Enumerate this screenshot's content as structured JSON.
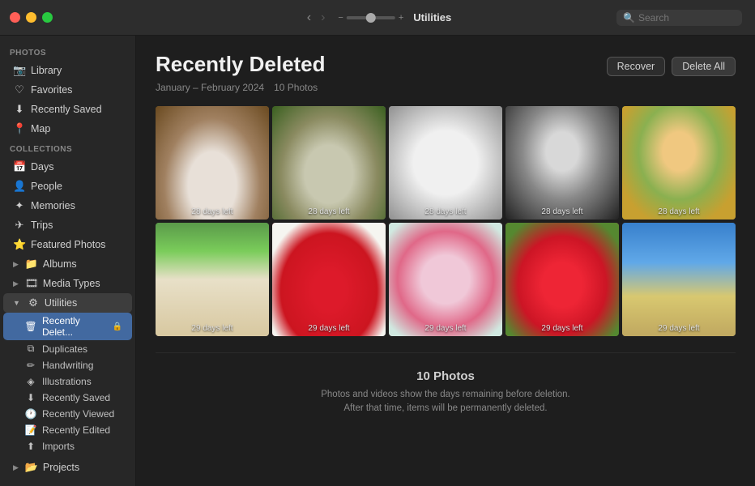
{
  "window": {
    "title": "Utilities",
    "search_placeholder": "Search"
  },
  "sidebar": {
    "photos_section": "Photos",
    "collections_section": "Collections",
    "photos_items": [
      {
        "id": "library",
        "label": "Library",
        "icon": "📷"
      },
      {
        "id": "favorites",
        "label": "Favorites",
        "icon": "♡"
      },
      {
        "id": "recently-saved",
        "label": "Recently Saved",
        "icon": "⬇"
      },
      {
        "id": "map",
        "label": "Map",
        "icon": "📍"
      }
    ],
    "collections_items": [
      {
        "id": "days",
        "label": "Days",
        "icon": "📅"
      },
      {
        "id": "people",
        "label": "People",
        "icon": "👤"
      },
      {
        "id": "memories",
        "label": "Memories",
        "icon": "✦"
      },
      {
        "id": "trips",
        "label": "Trips",
        "icon": "✈"
      },
      {
        "id": "featured-photos",
        "label": "Featured Photos",
        "icon": "⭐"
      },
      {
        "id": "albums",
        "label": "Albums",
        "icon": "📁"
      },
      {
        "id": "media-types",
        "label": "Media Types",
        "icon": "🎞"
      },
      {
        "id": "utilities",
        "label": "Utilities",
        "icon": "⚙",
        "expanded": true
      }
    ],
    "utilities_subitems": [
      {
        "id": "recently-deleted",
        "label": "Recently Delet...",
        "icon": "🗑",
        "active": true
      },
      {
        "id": "duplicates",
        "label": "Duplicates",
        "icon": "⧉"
      },
      {
        "id": "handwriting",
        "label": "Handwriting",
        "icon": "✏"
      },
      {
        "id": "illustrations",
        "label": "Illustrations",
        "icon": "◈"
      },
      {
        "id": "recently-saved-util",
        "label": "Recently Saved",
        "icon": "⬇"
      },
      {
        "id": "recently-viewed",
        "label": "Recently Viewed",
        "icon": "🕐"
      },
      {
        "id": "recently-edited",
        "label": "Recently Edited",
        "icon": "📝"
      },
      {
        "id": "imports",
        "label": "Imports",
        "icon": "⬆"
      }
    ],
    "projects_item": {
      "id": "projects",
      "label": "Projects",
      "icon": "📂"
    }
  },
  "content": {
    "title": "Recently Deleted",
    "date_range": "January – February 2024",
    "photo_count_header": "10 Photos",
    "recover_label": "Recover",
    "delete_all_label": "Delete All",
    "photos": [
      {
        "id": 1,
        "style_class": "photo-dog1",
        "overlay_class": "photo-dog1-overlay",
        "label": "28 days left"
      },
      {
        "id": 2,
        "style_class": "photo-dog2",
        "overlay_class": "photo-dog2-overlay",
        "label": "28 days left"
      },
      {
        "id": 3,
        "style_class": "photo-dog3",
        "overlay_class": "photo-dog3-overlay",
        "label": "28 days left"
      },
      {
        "id": 4,
        "style_class": "photo-girl1",
        "overlay_class": "photo-girl1-overlay",
        "label": "28 days left"
      },
      {
        "id": 5,
        "style_class": "photo-girl2",
        "overlay_class": "photo-girl2-overlay",
        "label": "28 days left"
      },
      {
        "id": 6,
        "style_class": "photo-house",
        "overlay_class": "photo-house-overlay",
        "label": "29 days left"
      },
      {
        "id": 7,
        "style_class": "photo-berries1",
        "overlay_class": "photo-berries1-overlay",
        "label": "29 days left"
      },
      {
        "id": 8,
        "style_class": "photo-cake",
        "overlay_class": "photo-cake-overlay",
        "label": "29 days left"
      },
      {
        "id": 9,
        "style_class": "photo-berries2",
        "overlay_class": "photo-berries2-overlay",
        "label": "29 days left"
      },
      {
        "id": 10,
        "style_class": "photo-beach",
        "overlay_class": "photo-beach-overlay",
        "label": "29 days left"
      }
    ],
    "footer": {
      "count": "10 Photos",
      "desc_line1": "Photos and videos show the days remaining before deletion.",
      "desc_line2": "After that time, items will be permanently deleted."
    }
  },
  "colors": {
    "accent": "#4269a0",
    "bg_sidebar": "#272727",
    "bg_content": "#1e1e1e",
    "bg_titlebar": "#2d2d2d"
  }
}
